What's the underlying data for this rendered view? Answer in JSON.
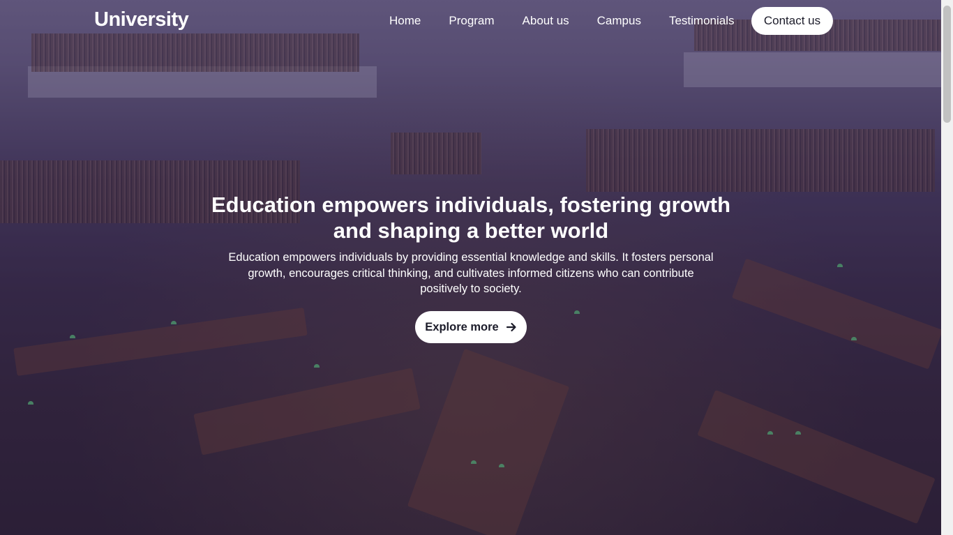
{
  "brand": {
    "name": "University"
  },
  "nav": {
    "items": [
      {
        "label": "Home"
      },
      {
        "label": "Program"
      },
      {
        "label": "About us"
      },
      {
        "label": "Campus"
      },
      {
        "label": "Testimonials"
      }
    ],
    "contact_label": "Contact us"
  },
  "hero": {
    "headline": "Education empowers individuals, fostering growth and shaping a better world",
    "subtext": "Education empowers individuals by providing essential knowledge and skills. It fosters personal growth, encourages critical thinking, and cultivates informed citizens who can contribute positively to society.",
    "cta_label": "Explore more",
    "cta_icon": "arrow-right-icon",
    "background": "library-reading-room-photo"
  },
  "colors": {
    "overlay": "#2f2346",
    "button_bg": "#ffffff",
    "button_text": "#1c1c2a",
    "text": "#ffffff"
  }
}
